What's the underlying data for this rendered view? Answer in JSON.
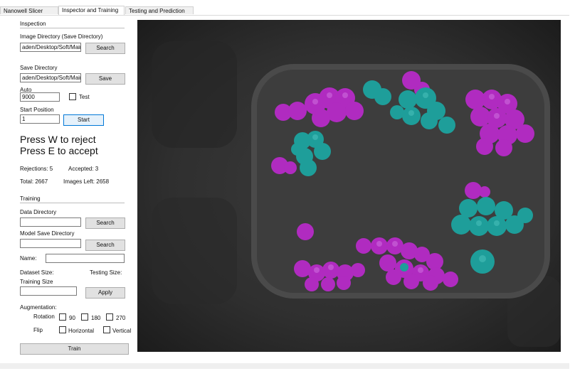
{
  "tabs": [
    "Nanowell Slicer",
    "Inspector and Training",
    "Testing and Prediction"
  ],
  "inspection": {
    "header": "Inspection",
    "image_dir_label": "Image Directory (Save Directory)",
    "image_dir_value": "aden/Desktop/Soft/Main",
    "search_label": "Search",
    "save_dir_label": "Save Directory",
    "save_dir_value": "aden/Desktop/Soft/Main",
    "save_label": "Save",
    "auto_label": "Auto",
    "auto_value": "9000",
    "test_label": "Test",
    "start_pos_label": "Start Position",
    "start_pos_value": "1",
    "start_label": "Start",
    "instruction_reject": "Press W to reject",
    "instruction_accept": "Press E to accept",
    "rejections": "Rejections: 5",
    "accepted": "Accepted: 3",
    "total": "Total: 2667",
    "images_left": "Images Left: 2658"
  },
  "training": {
    "header": "Training",
    "data_dir_label": "Data Directory",
    "data_dir_value": "",
    "search_label": "Search",
    "model_dir_label": "Model Save Directory",
    "model_dir_value": "",
    "search2_label": "Search",
    "name_label": "Name:",
    "name_value": "",
    "dataset_size_label": "Dataset Size:",
    "testing_size_label": "Testing Size:",
    "training_size_label": "Training Size",
    "training_size_value": "",
    "apply_label": "Apply",
    "augmentation_label": "Augmentation:",
    "rotation_label": "Rotation",
    "rot_90": "90",
    "rot_180": "180",
    "rot_270": "270",
    "flip_label": "Flip",
    "flip_h": "Horizontal",
    "flip_v": "Vertical",
    "train_label": "Train"
  },
  "colors": {
    "magenta": "#b02bc0",
    "teal": "#1e9e9a",
    "well_bg": "#3a3a3a"
  }
}
